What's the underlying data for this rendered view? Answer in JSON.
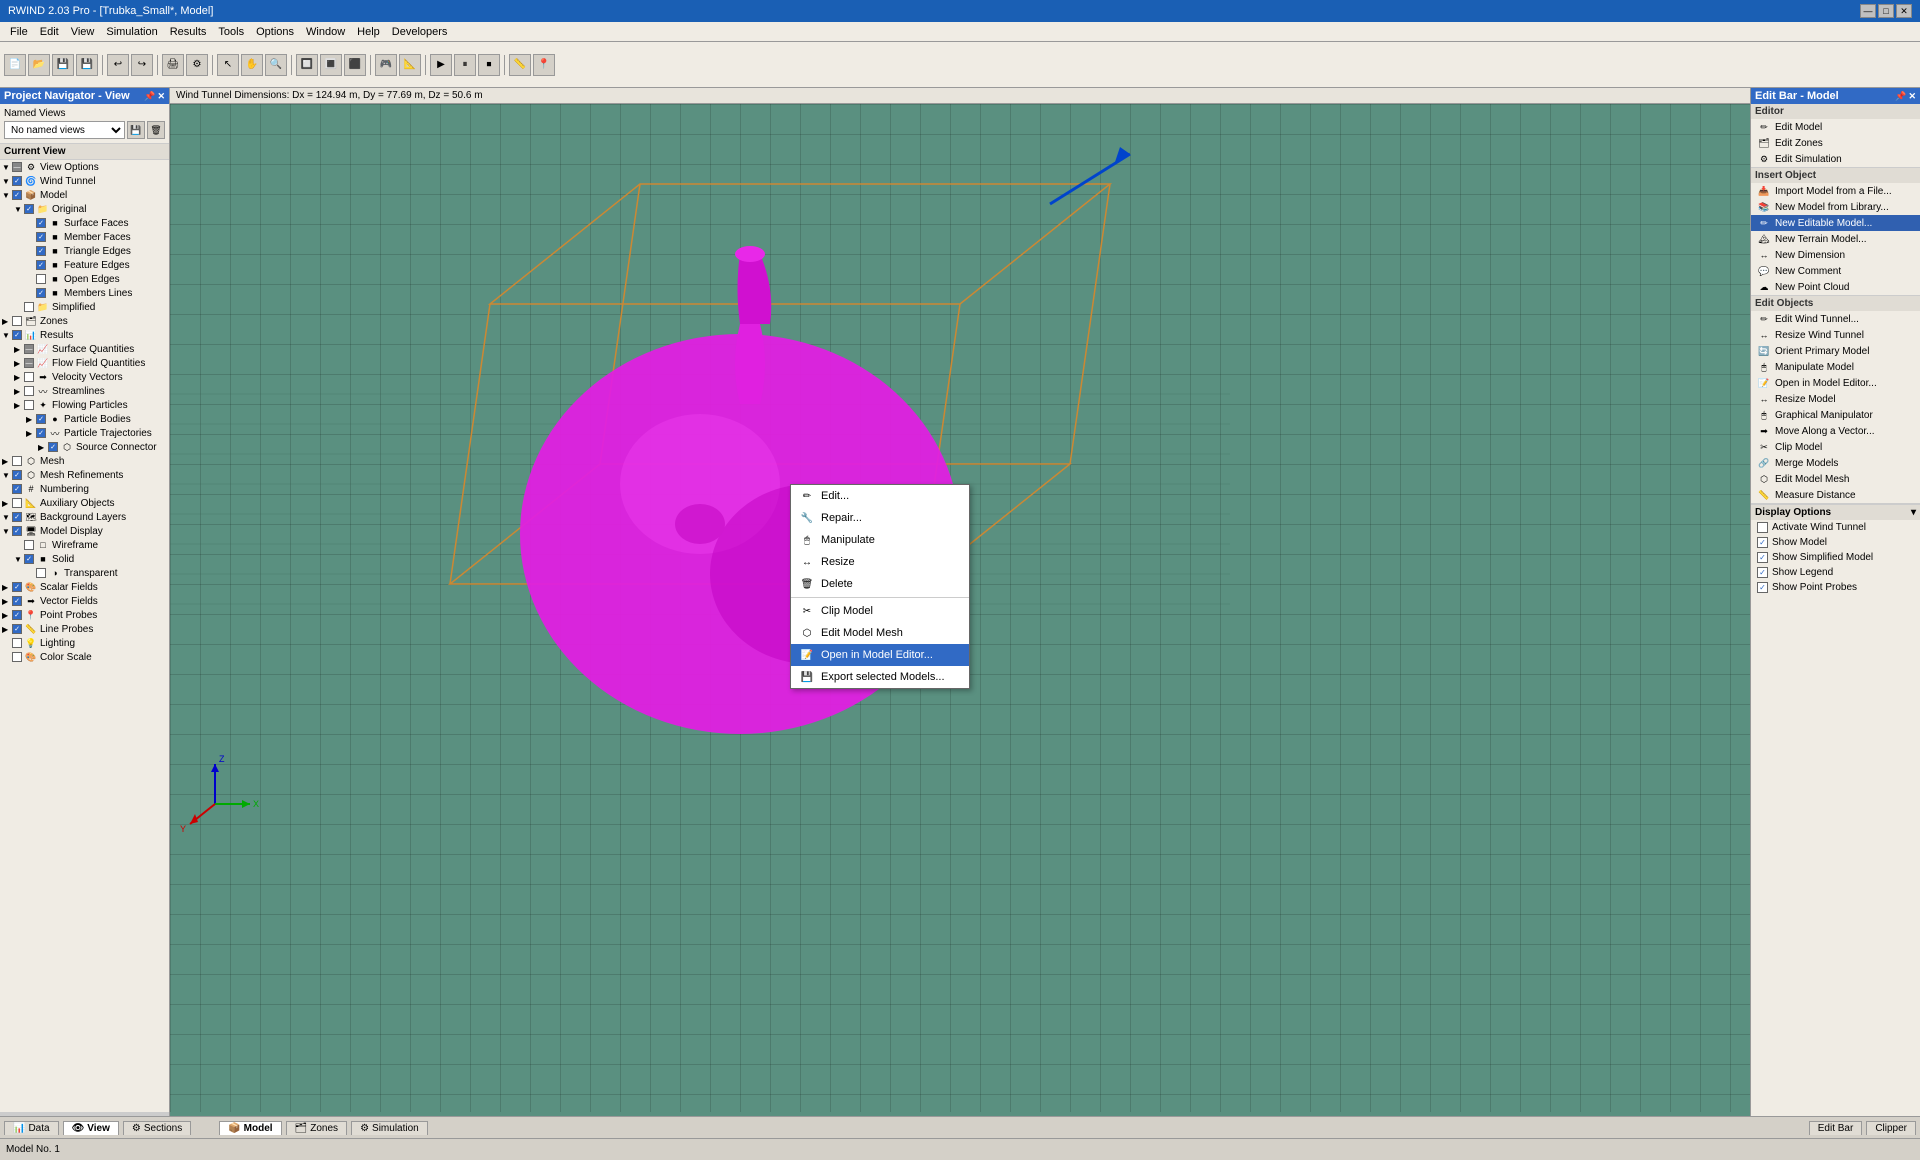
{
  "titlebar": {
    "title": "RWIND 2.03 Pro - [Trubka_Small*, Model]",
    "buttons": [
      "—",
      "□",
      "✕"
    ]
  },
  "menubar": {
    "items": [
      "File",
      "Edit",
      "View",
      "Simulation",
      "Results",
      "Tools",
      "Options",
      "Window",
      "Help",
      "Developers"
    ]
  },
  "viewport": {
    "header": "Wind Tunnel Dimensions: Dx = 124.94 m, Dy = 77.69 m, Dz = 50.6 m"
  },
  "left_panel": {
    "title": "Project Navigator - View",
    "named_views_label": "Named Views",
    "named_views_placeholder": "No named views",
    "current_view_label": "Current View",
    "tree": [
      {
        "level": 0,
        "expand": "▼",
        "checked": "partial",
        "icon": "⚙",
        "label": "View Options"
      },
      {
        "level": 0,
        "expand": "▼",
        "checked": "checked",
        "icon": "🌀",
        "label": "Wind Tunnel"
      },
      {
        "level": 0,
        "expand": "▼",
        "checked": "checked",
        "icon": "📦",
        "label": "Model"
      },
      {
        "level": 1,
        "expand": "▼",
        "checked": "checked",
        "icon": "📁",
        "label": "Original"
      },
      {
        "level": 2,
        "expand": "",
        "checked": "checked",
        "icon": "■",
        "label": "Surface Faces"
      },
      {
        "level": 2,
        "expand": "",
        "checked": "checked",
        "icon": "■",
        "label": "Member Faces"
      },
      {
        "level": 2,
        "expand": "",
        "checked": "checked",
        "icon": "■",
        "label": "Triangle Edges"
      },
      {
        "level": 2,
        "expand": "",
        "checked": "checked",
        "icon": "■",
        "label": "Feature Edges"
      },
      {
        "level": 2,
        "expand": "",
        "checked": "",
        "icon": "■",
        "label": "Open Edges"
      },
      {
        "level": 2,
        "expand": "",
        "checked": "checked",
        "icon": "■",
        "label": "Members Lines"
      },
      {
        "level": 1,
        "expand": "",
        "checked": "",
        "icon": "📁",
        "label": "Simplified"
      },
      {
        "level": 0,
        "expand": "▶",
        "checked": "",
        "icon": "🗂",
        "label": "Zones"
      },
      {
        "level": 0,
        "expand": "▼",
        "checked": "checked",
        "icon": "📊",
        "label": "Results"
      },
      {
        "level": 1,
        "expand": "▶",
        "checked": "partial",
        "icon": "📈",
        "label": "Surface Quantities"
      },
      {
        "level": 1,
        "expand": "▶",
        "checked": "partial",
        "icon": "📈",
        "label": "Flow Field Quantities"
      },
      {
        "level": 1,
        "expand": "▶",
        "checked": "",
        "icon": "➡",
        "label": "Velocity Vectors"
      },
      {
        "level": 1,
        "expand": "▶",
        "checked": "",
        "icon": "〰",
        "label": "Streamlines"
      },
      {
        "level": 1,
        "expand": "▶",
        "checked": "",
        "icon": "✦",
        "label": "Flowing Particles"
      },
      {
        "level": 2,
        "expand": "▶",
        "checked": "checked",
        "icon": "●",
        "label": "Particle Bodies"
      },
      {
        "level": 2,
        "expand": "▶",
        "checked": "checked",
        "icon": "〰",
        "label": "Particle Trajectories"
      },
      {
        "level": 3,
        "expand": "▶",
        "checked": "checked",
        "icon": "⬡",
        "label": "Source Connector"
      },
      {
        "level": 0,
        "expand": "▶",
        "checked": "",
        "icon": "⬡",
        "label": "Mesh"
      },
      {
        "level": 0,
        "expand": "▼",
        "checked": "checked",
        "icon": "⬡",
        "label": "Mesh Refinements"
      },
      {
        "level": 0,
        "expand": "",
        "checked": "checked",
        "icon": "#",
        "label": "Numbering"
      },
      {
        "level": 0,
        "expand": "▶",
        "checked": "",
        "icon": "📐",
        "label": "Auxiliary Objects"
      },
      {
        "level": 0,
        "expand": "▼",
        "checked": "checked",
        "icon": "🗺",
        "label": "Background Layers"
      },
      {
        "level": 0,
        "expand": "▼",
        "checked": "checked",
        "icon": "🖥",
        "label": "Model Display"
      },
      {
        "level": 1,
        "expand": "",
        "checked": "",
        "icon": "□",
        "label": "Wireframe"
      },
      {
        "level": 1,
        "expand": "▼",
        "checked": "checked",
        "icon": "■",
        "label": "Solid"
      },
      {
        "level": 2,
        "expand": "",
        "checked": "",
        "icon": "◑",
        "label": "Transparent"
      },
      {
        "level": 0,
        "expand": "▶",
        "checked": "checked",
        "icon": "🎨",
        "label": "Scalar Fields"
      },
      {
        "level": 0,
        "expand": "▶",
        "checked": "checked",
        "icon": "➡",
        "label": "Vector Fields"
      },
      {
        "level": 0,
        "expand": "▶",
        "checked": "checked",
        "icon": "📍",
        "label": "Point Probes"
      },
      {
        "level": 0,
        "expand": "▶",
        "checked": "checked",
        "icon": "📏",
        "label": "Line Probes"
      },
      {
        "level": 0,
        "expand": "",
        "checked": "",
        "icon": "💡",
        "label": "Lighting"
      },
      {
        "level": 0,
        "expand": "",
        "checked": "",
        "icon": "🎨",
        "label": "Color Scale"
      }
    ]
  },
  "right_panel": {
    "title": "Edit Bar - Model",
    "editor_section": {
      "label": "Editor",
      "items": [
        {
          "icon": "✏",
          "label": "Edit Model"
        },
        {
          "icon": "🗂",
          "label": "Edit Zones"
        },
        {
          "icon": "⚙",
          "label": "Edit Simulation"
        }
      ]
    },
    "insert_section": {
      "label": "Insert Object",
      "items": [
        {
          "icon": "📥",
          "label": "Import Model from a File..."
        },
        {
          "icon": "📚",
          "label": "New Model from Library..."
        },
        {
          "icon": "✏",
          "label": "New Editable Model..."
        },
        {
          "icon": "🏔",
          "label": "New Terrain Model..."
        },
        {
          "icon": "↔",
          "label": "New Dimension"
        },
        {
          "icon": "💬",
          "label": "New Comment"
        },
        {
          "icon": "☁",
          "label": "New Point Cloud"
        }
      ]
    },
    "objects_section": {
      "label": "Edit Objects",
      "items": [
        {
          "icon": "✏",
          "label": "Edit Wind Tunnel..."
        },
        {
          "icon": "↔",
          "label": "Resize Wind Tunnel"
        },
        {
          "icon": "🔄",
          "label": "Orient Primary Model"
        },
        {
          "icon": "🖱",
          "label": "Manipulate Model"
        },
        {
          "icon": "📝",
          "label": "Open in Model Editor..."
        },
        {
          "icon": "↔",
          "label": "Resize Model"
        },
        {
          "icon": "🖱",
          "label": "Graphical Manipulator"
        },
        {
          "icon": "➡",
          "label": "Move Along a Vector..."
        },
        {
          "icon": "✂",
          "label": "Clip Model"
        },
        {
          "icon": "🔗",
          "label": "Merge Models"
        },
        {
          "icon": "⬡",
          "label": "Edit Model Mesh"
        },
        {
          "icon": "📏",
          "label": "Measure Distance"
        }
      ]
    },
    "display_section": {
      "label": "Display Options",
      "items": [
        {
          "checked": false,
          "label": "Activate Wind Tunnel"
        },
        {
          "checked": true,
          "label": "Show Model"
        },
        {
          "checked": true,
          "label": "Show Simplified Model"
        },
        {
          "checked": true,
          "label": "Show Legend"
        },
        {
          "checked": true,
          "label": "Show Point Probes"
        }
      ]
    }
  },
  "context_menu": {
    "items": [
      {
        "icon": "✏",
        "label": "Edit..."
      },
      {
        "icon": "🔧",
        "label": "Repair..."
      },
      {
        "icon": "🖱",
        "label": "Manipulate"
      },
      {
        "icon": "↔",
        "label": "Resize"
      },
      {
        "icon": "🗑",
        "label": "Delete"
      },
      {
        "separator": true
      },
      {
        "icon": "✂",
        "label": "Clip Model"
      },
      {
        "icon": "⬡",
        "label": "Edit Model Mesh"
      },
      {
        "icon": "📝",
        "label": "Open in Model Editor...",
        "highlighted": true
      },
      {
        "icon": "💾",
        "label": "Export selected Models..."
      }
    ]
  },
  "bottom_tabs": {
    "viewport_tabs": [
      {
        "icon": "📊",
        "label": "Data"
      },
      {
        "icon": "👁",
        "label": "View",
        "active": true
      },
      {
        "icon": "⚙",
        "label": "Sections"
      }
    ],
    "model_tabs": [
      {
        "icon": "📦",
        "label": "Model",
        "active": true
      },
      {
        "icon": "🗂",
        "label": "Zones"
      },
      {
        "icon": "⚙",
        "label": "Simulation"
      }
    ],
    "right_tabs": [
      {
        "label": "Edit Bar"
      },
      {
        "label": "Clipper"
      }
    ]
  },
  "status_bar": {
    "text": "Model No. 1"
  }
}
